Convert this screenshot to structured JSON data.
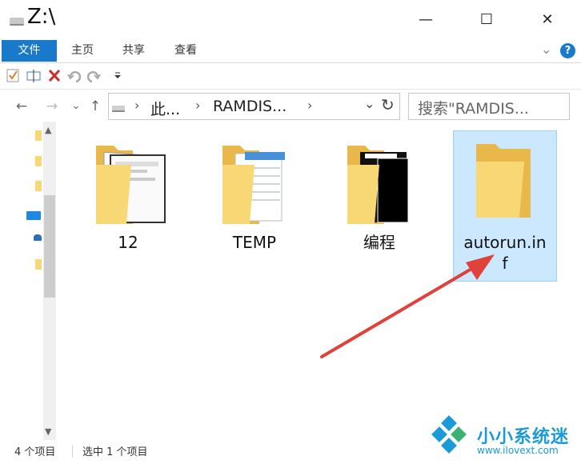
{
  "window": {
    "title": "Z:\\",
    "minimize_glyph": "—",
    "maximize_glyph": "☐",
    "close_glyph": "✕"
  },
  "ribbon": {
    "tabs": [
      "文件",
      "主页",
      "共享",
      "查看"
    ],
    "expand_glyph": "⌄",
    "help_glyph": "?"
  },
  "address_bar": {
    "segments": [
      "此...",
      "RAMDIS..."
    ],
    "dropdown_glyph": "⌄",
    "refresh_glyph": "↻"
  },
  "search": {
    "placeholder": "搜索\"RAMDIS..."
  },
  "items": [
    {
      "name": "12",
      "type": "folder-with-docs"
    },
    {
      "name": "TEMP",
      "type": "folder-with-notepad"
    },
    {
      "name": "编程",
      "type": "folder-dark"
    },
    {
      "name": "autorun.in",
      "name_line2": "f",
      "type": "folder",
      "selected": true
    }
  ],
  "status_bar": {
    "item_count": "4 个项目",
    "selection": "选中 1 个项目"
  },
  "watermark": {
    "text": "小小系统迷",
    "url": "www.ilovext.com"
  },
  "colors": {
    "accent": "#1979ca",
    "selection_bg": "#cce8ff",
    "selection_border": "#99d1ff",
    "folder": "#f8d775",
    "arrow": "#e0413a",
    "watermark": "#1a9ad6"
  }
}
